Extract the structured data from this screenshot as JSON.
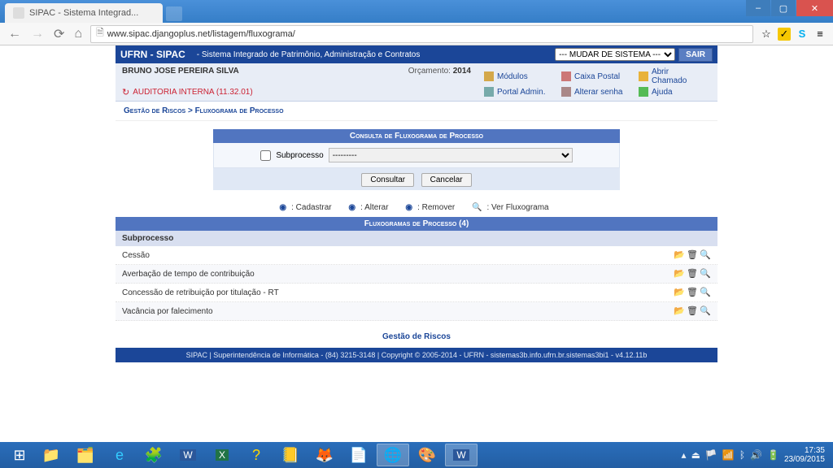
{
  "browser": {
    "tab_title": "SIPAC - Sistema Integrad...",
    "url": "www.sipac.djangoplus.net/listagem/fluxograma/"
  },
  "topbar": {
    "title": "UFRN - SIPAC",
    "subtitle": "- Sistema Integrado de Patrimônio, Administração e Contratos",
    "system_select": "--- MUDAR DE SISTEMA ---",
    "sair": "SAIR"
  },
  "userbar": {
    "username": "BRUNO JOSE PEREIRA SILVA",
    "orcamento_label": "Orçamento:",
    "orcamento_year": "2014",
    "department": "AUDITORIA INTERNA (11.32.01)",
    "links": {
      "modulos": "Módulos",
      "caixa": "Caixa Postal",
      "abrir": "Abrir Chamado",
      "portal": "Portal Admin.",
      "alterar": "Alterar senha",
      "ajuda": "Ajuda"
    }
  },
  "breadcrumb": "Gestão de Riscos > Fluxograma de Processo",
  "consulta": {
    "title": "Consulta de Fluxograma de Processo",
    "label_subprocesso": "Subprocesso",
    "select_value": "---------",
    "btn_consultar": "Consultar",
    "btn_cancelar": "Cancelar"
  },
  "legend": {
    "cadastrar": ": Cadastrar",
    "alterar": ": Alterar",
    "remover": ": Remover",
    "ver": ": Ver Fluxograma"
  },
  "table": {
    "title": "Fluxogramas de Processo (4)",
    "col_header": "Subprocesso",
    "rows": [
      {
        "name": "Cessão"
      },
      {
        "name": "Averbação de tempo de contribuição"
      },
      {
        "name": "Concessão de retribuição por titulação - RT"
      },
      {
        "name": "Vacância por falecimento"
      }
    ]
  },
  "back_link": "Gestão de Riscos",
  "footer": "SIPAC | Superintendência de Informática - (84) 3215-3148 | Copyright © 2005-2014 - UFRN - sistemas3b.info.ufrn.br.sistemas3bi1 - v4.12.11b",
  "taskbar": {
    "time": "17:35",
    "date": "23/09/2015"
  }
}
